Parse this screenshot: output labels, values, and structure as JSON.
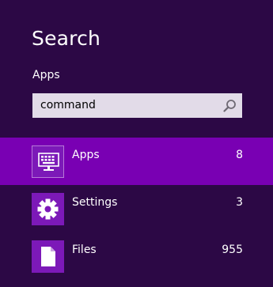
{
  "charm": {
    "title": "Search",
    "scope_label": "Apps"
  },
  "search": {
    "value": "command",
    "icon": "magnifier-icon"
  },
  "results": [
    {
      "label": "Apps",
      "count": "8",
      "icon": "keyboard-display-icon",
      "selected": true
    },
    {
      "label": "Settings",
      "count": "3",
      "icon": "gear-icon",
      "selected": false
    },
    {
      "label": "Files",
      "count": "955",
      "icon": "document-icon",
      "selected": false
    }
  ],
  "colors": {
    "background": "#2c0845",
    "selected_row": "#7900b3",
    "tile": "#7c19b8",
    "search_box": "#e2dbe8"
  }
}
